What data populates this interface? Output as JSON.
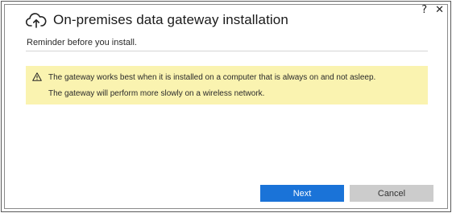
{
  "window": {
    "help_label": "?",
    "close_label": "✕"
  },
  "header": {
    "icon": "cloud-upload-icon",
    "title": "On-premises data gateway installation"
  },
  "subtitle": "Reminder before you install.",
  "warning": {
    "icon": "warning-triangle-icon",
    "lines": [
      "The gateway works best when it is installed on a computer that is always on and not asleep.",
      "The gateway will perform more slowly on a wireless network."
    ],
    "background": "#faf3b0"
  },
  "buttons": {
    "next_label": "Next",
    "cancel_label": "Cancel"
  },
  "colors": {
    "accent": "#1a73d8",
    "disabled": "#cccccc"
  }
}
